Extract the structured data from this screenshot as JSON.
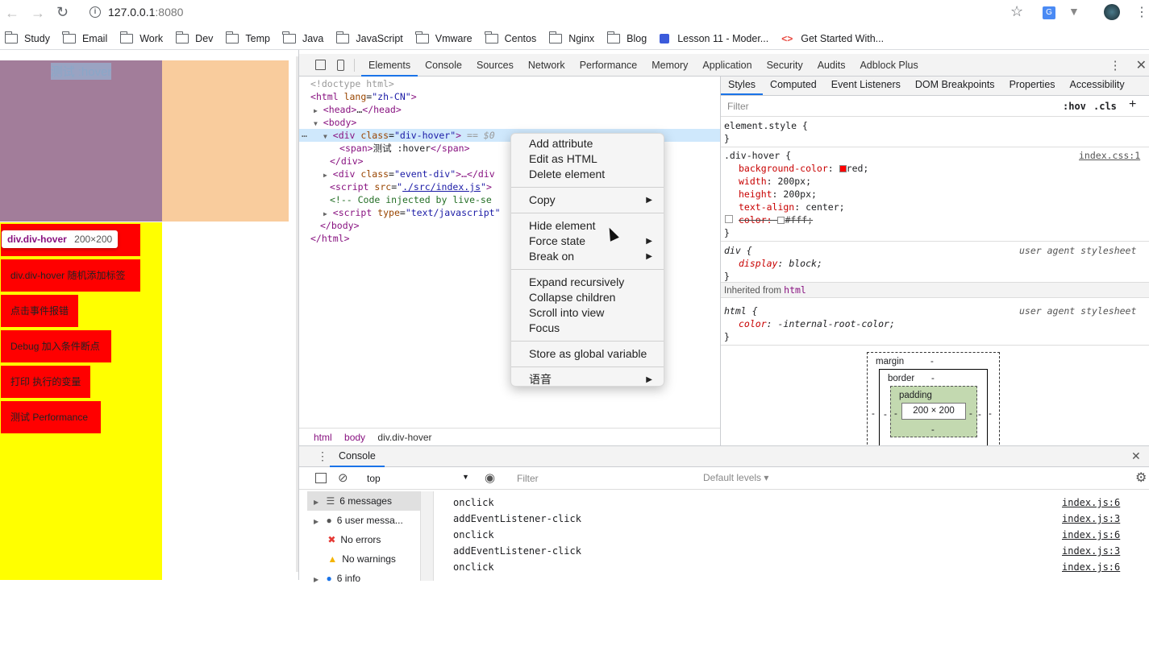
{
  "browser": {
    "url_host": "127.0.0.1",
    "url_port": ":8080",
    "bookmarks": [
      "Study",
      "Email",
      "Work",
      "Dev",
      "Temp",
      "Java",
      "JavaScript",
      "Vmware",
      "Centos",
      "Nginx",
      "Blog"
    ],
    "bookmark_extra_1": "Lesson 11 - Moder...",
    "bookmark_extra_2": "Get Started With..."
  },
  "page": {
    "hover_text": "测试 :hover",
    "tooltip_tag": "div.div-hover",
    "tooltip_size": "200×200",
    "buttons": [
      "div.div-hover 随机添加标签",
      "点击事件报错",
      "Debug 加入条件断点",
      "打印 执行的变量",
      "测试 Performance"
    ],
    "colors": {
      "hover_box": "#a27d9a",
      "orange": "#f9cc9d",
      "yellow": "#ffff00",
      "red": "#ff0000"
    }
  },
  "devtools": {
    "tabs": [
      "Elements",
      "Console",
      "Sources",
      "Network",
      "Performance",
      "Memory",
      "Application",
      "Security",
      "Audits",
      "Adblock Plus"
    ],
    "active_tab": "Elements",
    "dom": {
      "l1": "<!doctype html>",
      "l2_tag": "html",
      "l2_attr": "lang",
      "l2_val": "\"zh-CN\"",
      "l3": "head",
      "l3_ellipsis": "…",
      "l4": "body",
      "l5_tag": "div",
      "l5_attr": "class",
      "l5_val": "\"div-hover\"",
      "l5_eq": " == $0",
      "l6_tag": "span",
      "l6_text": "测试 :hover",
      "l7": "div",
      "l8_tag": "div",
      "l8_attr": "class",
      "l8_val": "\"event-div\"",
      "l8_rest": "…</div",
      "l9_tag": "script",
      "l9_attr": "src",
      "l9_val": "./src/index.js",
      "l10": "<!-- Code injected by live-se",
      "l11_tag": "script",
      "l11_attr": "type",
      "l11_val": "\"text/javascript\"",
      "l12": "body",
      "l13": "html"
    },
    "breadcrumbs": [
      "html",
      "body",
      "div.div-hover"
    ],
    "context_menu": {
      "group1": [
        "Add attribute",
        "Edit as HTML",
        "Delete element"
      ],
      "group2": [
        "Copy"
      ],
      "group3": [
        "Hide element",
        "Force state",
        "Break on"
      ],
      "group4": [
        "Expand recursively",
        "Collapse children",
        "Scroll into view",
        "Focus"
      ],
      "group5": [
        "Store as global variable"
      ],
      "group6": [
        "语音"
      ]
    },
    "styles_tabs": [
      "Styles",
      "Computed",
      "Event Listeners",
      "DOM Breakpoints",
      "Properties",
      "Accessibility"
    ],
    "styles": {
      "filter_placeholder": "Filter",
      "hov": ":hov",
      "cls": ".cls",
      "element_style": "element.style {",
      "rule_selector": ".div-hover {",
      "rule_source": "index.css:1",
      "props": [
        {
          "name": "background-color",
          "value": "red;"
        },
        {
          "name": "width",
          "value": "200px;"
        },
        {
          "name": "height",
          "value": "200px;"
        },
        {
          "name": "text-align",
          "value": "center;"
        }
      ],
      "struck_prop": "color:",
      "struck_val": "#fff;",
      "ua_selector": "div {",
      "ua_source": "user agent stylesheet",
      "ua_prop": "display",
      "ua_val": "block;",
      "inherited_label": "Inherited from",
      "inherited_tag": "html",
      "html_selector": "html {",
      "html_prop": "color",
      "html_val": "-internal-root-color;",
      "close_brace": "}"
    },
    "box_model": {
      "margin": "margin",
      "border": "border",
      "padding": "padding",
      "dash": "-",
      "size": "200 × 200"
    },
    "console": {
      "drawer_tab": "Console",
      "context": "top",
      "filter_placeholder": "Filter",
      "levels": "Default levels",
      "sidebar": [
        "6 messages",
        "6 user messa...",
        "No errors",
        "No warnings",
        "6 info"
      ],
      "logs": [
        {
          "text": "onclick",
          "src": "index.js:6"
        },
        {
          "text": "addEventListener-click",
          "src": "index.js:3"
        },
        {
          "text": "onclick",
          "src": "index.js:6"
        },
        {
          "text": "addEventListener-click",
          "src": "index.js:3"
        },
        {
          "text": "onclick",
          "src": "index.js:6"
        }
      ]
    }
  }
}
